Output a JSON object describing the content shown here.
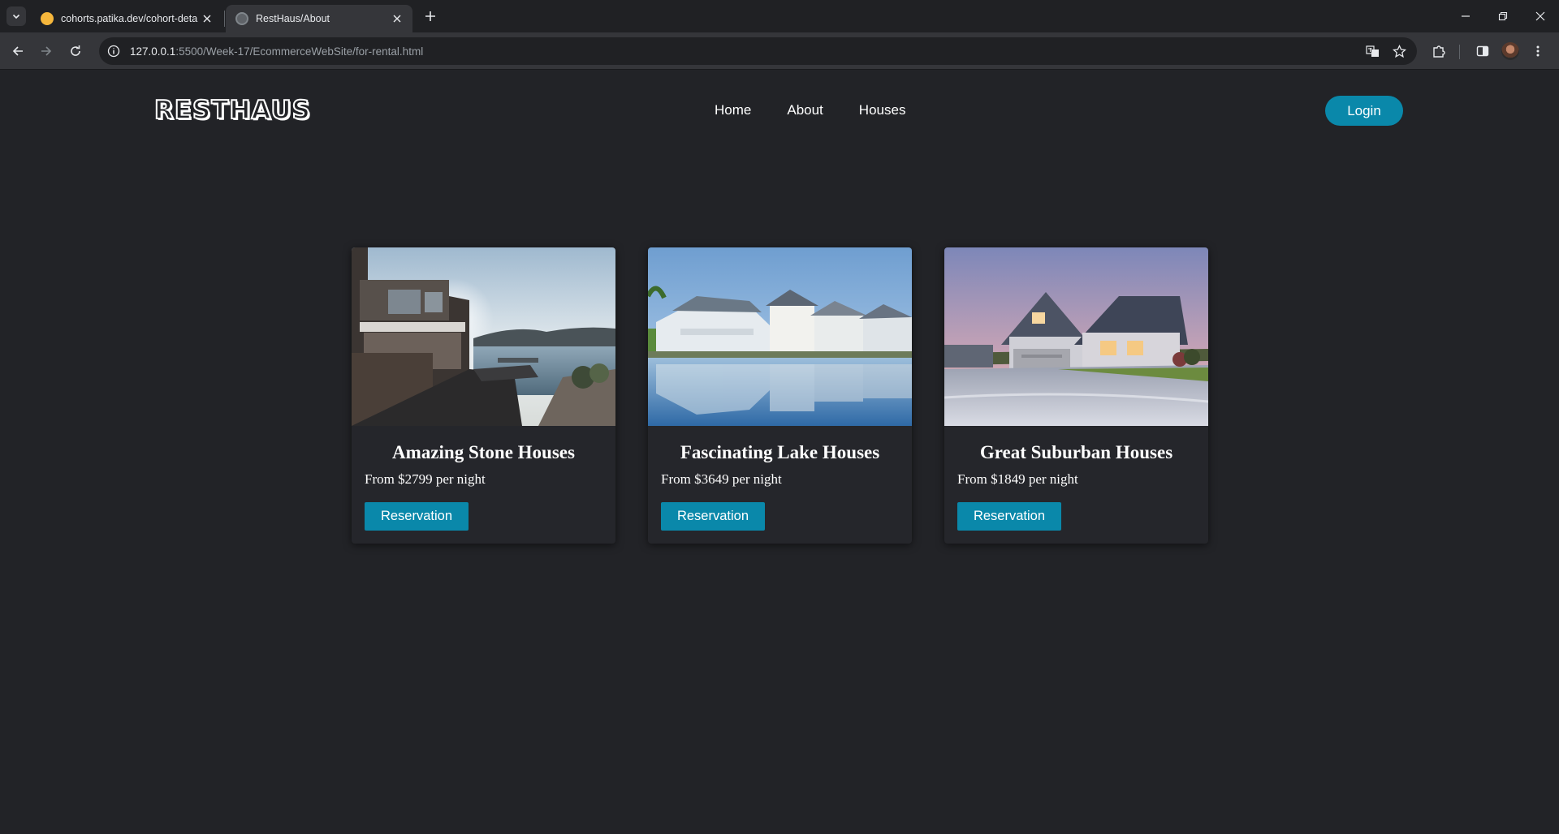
{
  "browser": {
    "tabs": [
      {
        "title": "cohorts.patika.dev/cohort-deta",
        "active": false,
        "favicon_color": "#f6b73c"
      },
      {
        "title": "RestHaus/About",
        "active": true,
        "favicon_color": "#5f6368"
      }
    ],
    "url_host": "127.0.0.1",
    "url_rest": ":5500/Week-17/EcommerceWebSite/for-rental.html"
  },
  "site": {
    "logo": "RESTHAUS",
    "nav": [
      "Home",
      "About",
      "Houses"
    ],
    "login_label": "Login",
    "accent_color": "#0a88aa",
    "background_color": "#222327"
  },
  "cards": [
    {
      "title": "Amazing Stone Houses",
      "price": "From $2799 per night",
      "button": "Reservation",
      "image": "stone house by a lake at sunset"
    },
    {
      "title": "Fascinating Lake Houses",
      "price": "From $3649 per night",
      "button": "Reservation",
      "image": "white houses reflected in calm lake"
    },
    {
      "title": "Great Suburban Houses",
      "price": "From $1849 per night",
      "button": "Reservation",
      "image": "suburban house with garage at dusk"
    }
  ]
}
